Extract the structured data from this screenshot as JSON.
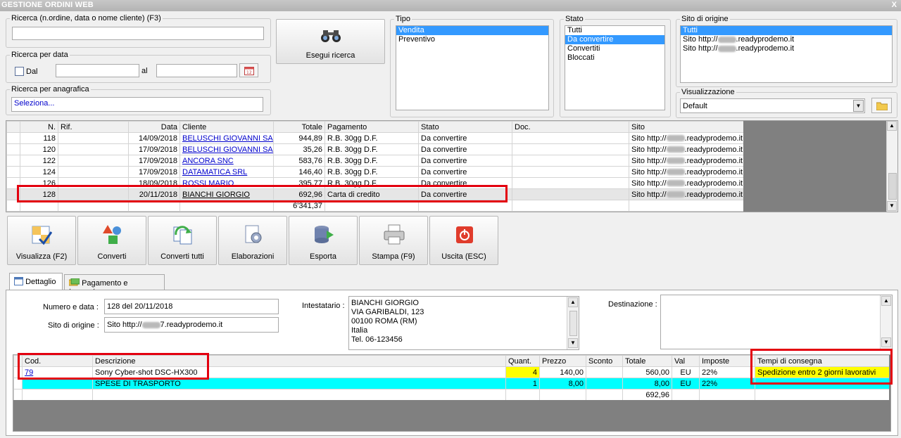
{
  "window": {
    "title": "GESTIONE ORDINI WEB",
    "close": "X"
  },
  "search": {
    "main_label": "Ricerca (n.ordine, data o nome cliente) (F3)",
    "main_value": "",
    "date_label": "Ricerca per data",
    "dal_label": "Dal",
    "al_label": "al",
    "date_from": "",
    "date_to": "",
    "anag_label": "Ricerca per anagrafica",
    "anag_value": "Seleziona...",
    "run_button": "Esegui ricerca"
  },
  "tipo": {
    "label": "Tipo",
    "options": [
      "Vendita",
      "Preventivo"
    ],
    "selected": 0
  },
  "stato": {
    "label": "Stato",
    "options": [
      "Tutti",
      "Da convertire",
      "Convertiti",
      "Bloccati"
    ],
    "selected": 1
  },
  "sito": {
    "label": "Sito di origine",
    "options": [
      {
        "prefix": "Tutti",
        "suffix": ""
      },
      {
        "prefix": "Sito http://",
        "suffix": ".readyprodemo.it"
      },
      {
        "prefix": "Sito http://",
        "suffix": ".readyprodemo.it"
      }
    ],
    "selected": 0
  },
  "visualizzazione": {
    "label": "Visualizzazione",
    "value": "Default"
  },
  "orders": {
    "columns": [
      "N.",
      "Rif.",
      "Data",
      "Cliente",
      "Totale",
      "Pagamento",
      "Stato",
      "Doc.",
      "Sito"
    ],
    "rows": [
      {
        "n": "118",
        "rif": "",
        "data": "14/09/2018",
        "cliente": "BELUSCHI GIOVANNI SAS",
        "totale": "944,89",
        "pagamento": "R.B. 30gg D.F.",
        "stato": "Da convertire",
        "doc": "",
        "sito_prefix": "Sito http://",
        "sito_suffix": ".readyprodemo.it"
      },
      {
        "n": "120",
        "rif": "",
        "data": "17/09/2018",
        "cliente": "BELUSCHI GIOVANNI SAS",
        "totale": "35,26",
        "pagamento": "R.B. 30gg D.F.",
        "stato": "Da convertire",
        "doc": "",
        "sito_prefix": "Sito http://",
        "sito_suffix": ".readyprodemo.it"
      },
      {
        "n": "122",
        "rif": "",
        "data": "17/09/2018",
        "cliente": "ANCORA SNC",
        "totale": "583,76",
        "pagamento": "R.B. 30gg D.F.",
        "stato": "Da convertire",
        "doc": "",
        "sito_prefix": "Sito http://",
        "sito_suffix": ".readyprodemo.it"
      },
      {
        "n": "124",
        "rif": "",
        "data": "17/09/2018",
        "cliente": "DATAMATICA SRL",
        "totale": "146,40",
        "pagamento": "R.B. 30gg D.F.",
        "stato": "Da convertire",
        "doc": "",
        "sito_prefix": "Sito http://",
        "sito_suffix": ".readyprodemo.it"
      },
      {
        "n": "126",
        "rif": "",
        "data": "18/09/2018",
        "cliente": "ROSSI MARIO",
        "totale": "395,77",
        "pagamento": "R.B. 30gg D.F.",
        "stato": "Da convertire",
        "doc": "",
        "sito_prefix": "Sito http://",
        "sito_suffix": ".readyprodemo.it"
      },
      {
        "n": "128",
        "rif": "",
        "data": "20/11/2018",
        "cliente": "BIANCHI GIORGIO",
        "totale": "692,96",
        "pagamento": "Carta di credito",
        "stato": "Da convertire",
        "doc": "",
        "sito_prefix": "Sito http://",
        "sito_suffix": ".readyprodemo.it"
      }
    ],
    "total": "6'341,37"
  },
  "toolbar": {
    "visualizza": "Visualizza (F2)",
    "converti": "Converti",
    "converti_tutti": "Converti tutti",
    "elaborazioni": "Elaborazioni",
    "esporta": "Esporta",
    "stampa": "Stampa (F9)",
    "uscita": "Uscita (ESC)"
  },
  "tabs": {
    "dettaglio": "Dettaglio",
    "pagamento": "Pagamento e trasporto"
  },
  "detail": {
    "numero_label": "Numero e data :",
    "numero_value": "128 del 20/11/2018",
    "sito_label": "Sito di origine :",
    "sito_prefix": "Sito http://",
    "sito_suffix": "7.readyprodemo.it",
    "intestatario_label": "Intestatario :",
    "intestatario_lines": [
      "BIANCHI GIORGIO",
      "VIA GARIBALDI, 123",
      "00100 ROMA (RM)",
      "Italia",
      "Tel. 06-123456"
    ],
    "destinazione_label": "Destinazione :",
    "destinazione_value": ""
  },
  "items": {
    "columns": [
      "Cod.",
      "Descrizione",
      "Quant.",
      "Prezzo",
      "Sconto",
      "Totale",
      "Val",
      "Imposte",
      "Tempi di consegna"
    ],
    "rows": [
      {
        "cod": "79",
        "descr": "Sony Cyber-shot DSC-HX300",
        "quant": "4",
        "prezzo": "140,00",
        "sconto": "",
        "totale": "560,00",
        "val": "EU",
        "imposte": "22%",
        "tempi": "Spedizione entro 2 giorni lavorativi"
      },
      {
        "cod": "",
        "descr": "SPESE DI TRASPORTO",
        "quant": "1",
        "prezzo": "8,00",
        "sconto": "",
        "totale": "8,00",
        "val": "EU",
        "imposte": "22%",
        "tempi": ""
      }
    ],
    "total": "692,96"
  }
}
